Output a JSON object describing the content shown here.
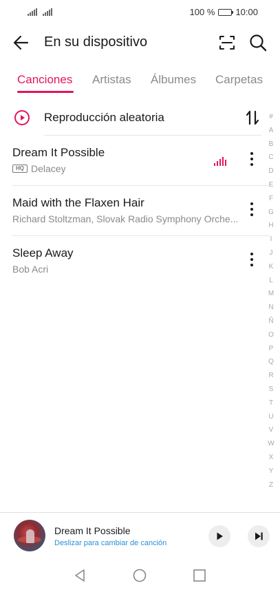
{
  "status": {
    "battery": "100 %",
    "battery_level": 1.0,
    "time": "10:00"
  },
  "header": {
    "title": "En su dispositivo",
    "back_icon": "arrow-left-icon",
    "scan_icon": "scan-icon",
    "search_icon": "search-icon"
  },
  "tabs": [
    {
      "label": "Canciones",
      "active": true
    },
    {
      "label": "Artistas",
      "active": false
    },
    {
      "label": "Álbumes",
      "active": false
    },
    {
      "label": "Carpetas",
      "active": false
    }
  ],
  "shuffle": {
    "label": "Reproducción aleatoria",
    "icon": "play-circle-icon",
    "sort_icon": "sort-icon"
  },
  "songs": [
    {
      "title": "Dream It Possible",
      "artist": "Delacey",
      "hq": true,
      "hq_label": "HQ",
      "playing": true
    },
    {
      "title": "Maid with the Flaxen Hair",
      "artist": "Richard Stoltzman, Slovak Radio Symphony Orche...",
      "hq": false,
      "playing": false
    },
    {
      "title": "Sleep Away",
      "artist": "Bob Acri",
      "hq": false,
      "playing": false
    }
  ],
  "alphabet_index": [
    "#",
    "A",
    "B",
    "C",
    "D",
    "E",
    "F",
    "G",
    "H",
    "I",
    "J",
    "K",
    "L",
    "M",
    "N",
    "Ñ",
    "O",
    "P",
    "Q",
    "R",
    "S",
    "T",
    "U",
    "V",
    "W",
    "X",
    "Y",
    "Z"
  ],
  "mini_player": {
    "title": "Dream It Possible",
    "hint": "Deslizar para cambiar de canción",
    "play_icon": "play-icon",
    "next_icon": "skip-next-icon"
  },
  "colors": {
    "accent": "#e8125c",
    "link": "#2a8fd6",
    "muted": "#8a8a8a"
  }
}
